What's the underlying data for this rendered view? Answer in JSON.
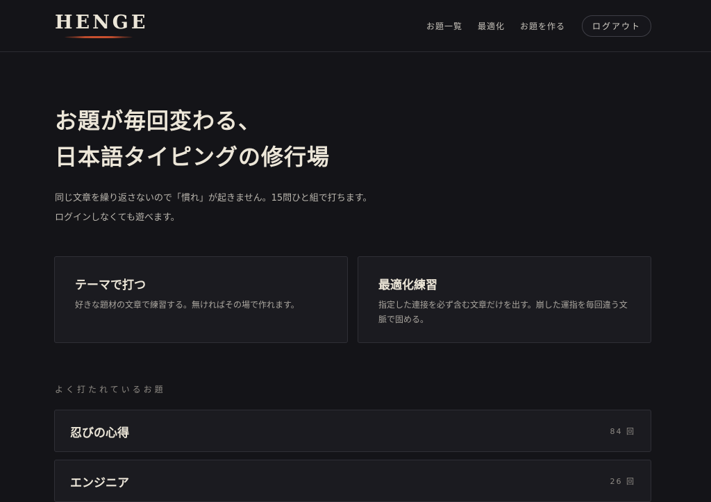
{
  "header": {
    "logo": "HENGE",
    "nav": {
      "topics": "お題一覧",
      "optimize": "最適化",
      "create": "お題を作る",
      "logout": "ログアウト"
    }
  },
  "hero": {
    "title_line1": "お題が毎回変わる、",
    "title_line2": "日本語タイピングの修行場",
    "desc_line1": "同じ文章を繰り返さないので「慣れ」が起きません。15問ひと組で打ちます。",
    "desc_line2": "ログインしなくても遊べます。"
  },
  "cards": [
    {
      "title": "テーマで打つ",
      "desc": "好きな題材の文章で練習する。無ければその場で作れます。"
    },
    {
      "title": "最適化練習",
      "desc": "指定した連接を必ず含む文章だけを出す。崩した運指を毎回違う文脈で固める。"
    }
  ],
  "popular": {
    "label": "よく打たれているお題",
    "items": [
      {
        "title": "忍びの心得",
        "count": "84 回"
      },
      {
        "title": "エンジニア",
        "count": "26 回"
      }
    ]
  },
  "colors": {
    "background": "#141418",
    "card": "#1b1b20",
    "accent": "#c8502f",
    "text": "#ece6d8"
  }
}
